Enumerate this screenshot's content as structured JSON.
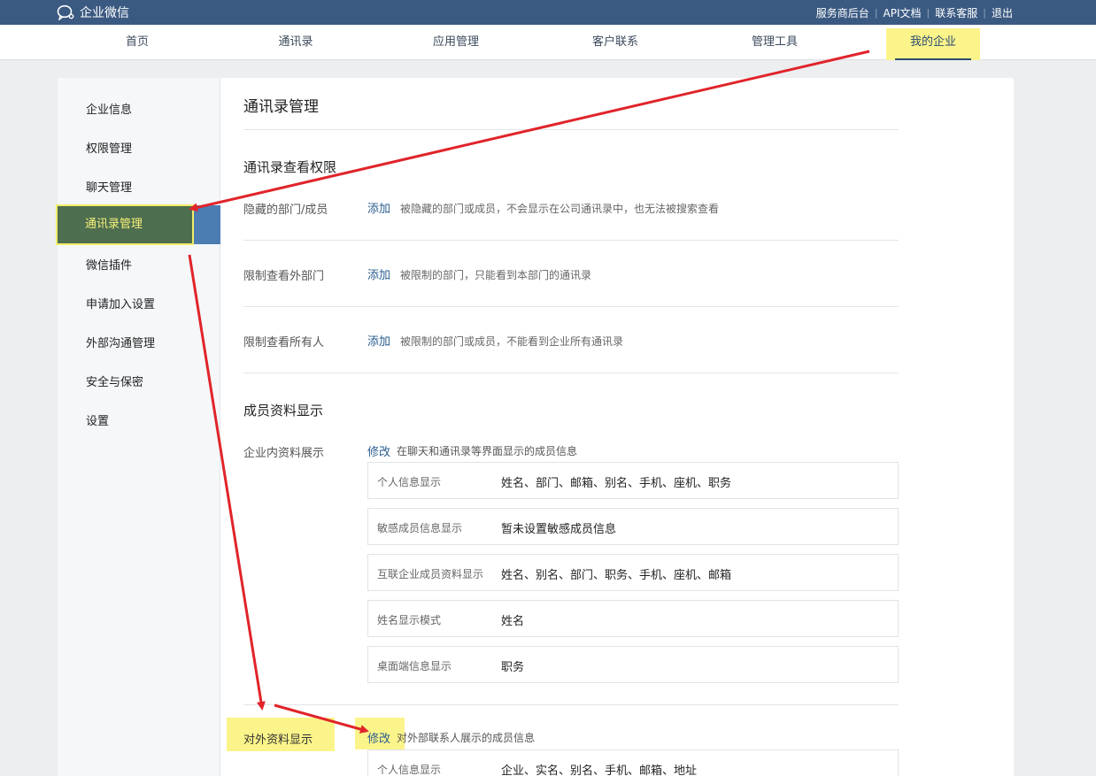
{
  "brand": {
    "name": "企业微信"
  },
  "top_links": [
    "服务商后台",
    "API文档",
    "联系客服",
    "退出"
  ],
  "nav": {
    "items": [
      "首页",
      "通讯录",
      "应用管理",
      "客户联系",
      "管理工具",
      "我的企业"
    ],
    "active": "我的企业"
  },
  "sidebar": {
    "items": [
      "企业信息",
      "权限管理",
      "聊天管理",
      "通讯录管理",
      "微信插件",
      "申请加入设置",
      "外部沟通管理",
      "安全与保密",
      "设置"
    ],
    "active": "通讯录管理"
  },
  "content": {
    "title": "通讯录管理",
    "view_permission": {
      "title": "通讯录查看权限",
      "rows": [
        {
          "label": "隐藏的部门/成员",
          "action": "添加",
          "desc": "被隐藏的部门或成员，不会显示在公司通讯录中，也无法被搜索查看"
        },
        {
          "label": "限制查看外部门",
          "action": "添加",
          "desc": "被限制的部门，只能看到本部门的通讯录"
        },
        {
          "label": "限制查看所有人",
          "action": "添加",
          "desc": "被限制的部门或成员，不能看到企业所有通讯录"
        }
      ]
    },
    "member_display": {
      "title": "成员资料显示",
      "internal": {
        "label": "企业内资料展示",
        "action": "修改",
        "desc": "在聊天和通讯录等界面显示的成员信息",
        "fields": [
          {
            "key": "个人信息显示",
            "value": "姓名、部门、邮箱、别名、手机、座机、职务"
          },
          {
            "key": "敏感成员信息显示",
            "value": "暂未设置敏感成员信息"
          },
          {
            "key": "互联企业成员资料显示",
            "value": "姓名、别名、部门、职务、手机、座机、邮箱"
          },
          {
            "key": "姓名显示模式",
            "value": "姓名"
          },
          {
            "key": "桌面端信息显示",
            "value": "职务"
          }
        ]
      },
      "external": {
        "label": "对外资料显示",
        "action": "修改",
        "desc": "对外部联系人展示的成员信息",
        "fields": [
          {
            "key": "个人信息显示",
            "value": "企业、实名、别名、手机、邮箱、地址"
          }
        ]
      }
    }
  },
  "colors": {
    "topbar": "#3b5a82",
    "highlight": "#fbf48a",
    "link": "#2a5d8f",
    "sidebar_active": "#4d6e4f",
    "arrow": "#e0242a"
  }
}
